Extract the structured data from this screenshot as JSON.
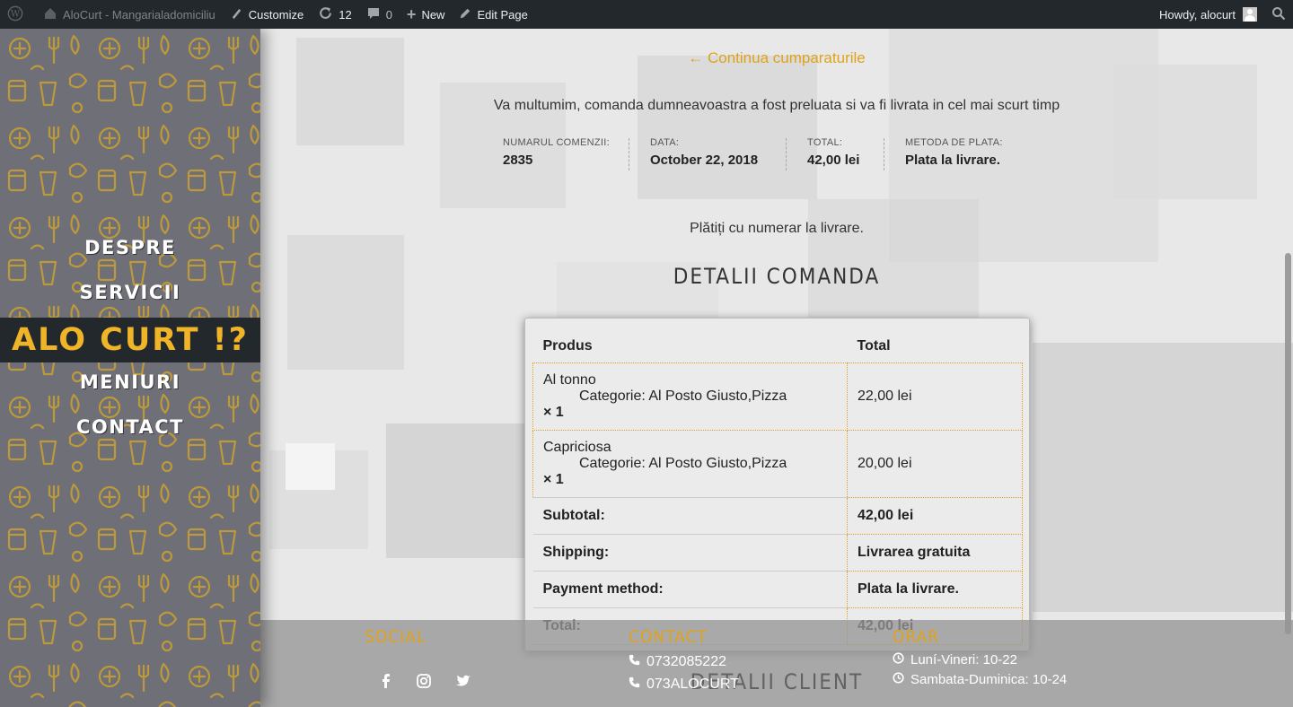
{
  "admin_bar": {
    "site_name": "AloCurt - Mangarialadomiciliu",
    "customize": "Customize",
    "updates_count": "12",
    "comments_count": "0",
    "new": "New",
    "edit_page": "Edit Page",
    "howdy": "Howdy, alocurt"
  },
  "sidebar": {
    "nav": [
      "DESPRE",
      "SERVICII",
      "MENIURI",
      "CONTACT"
    ],
    "logo_text": "ALO CURT !?",
    "accent": "#f0b429"
  },
  "main": {
    "continue_link": "← Continua cumparaturile",
    "thanks": "Va multumim, comanda dumneavoastra a fost preluata si va fi livrata in cel mai scurt timp",
    "overview": {
      "order_number_label": "NUMARUL COMENZII:",
      "order_number": "2835",
      "date_label": "DATA:",
      "date": "October 22, 2018",
      "total_label": "TOTAL:",
      "total": "42,00 lei",
      "method_label": "METODA DE PLATA:",
      "method": "Plata la livrare."
    },
    "payment_note": "Plătiți cu numerar la livrare.",
    "details_title": "DETALII COMANDA",
    "table": {
      "head_product": "Produs",
      "head_total": "Total",
      "items": [
        {
          "name": "Al tonno",
          "meta": "Categorie: Al Posto Giusto,Pizza",
          "qty": "× 1",
          "total": "22,00 lei"
        },
        {
          "name": "Capriciosa",
          "meta": "Categorie: Al Posto Giusto,Pizza",
          "qty": "× 1",
          "total": "20,00 lei"
        }
      ],
      "totals": [
        {
          "label": "Subtotal:",
          "value": "42,00 lei"
        },
        {
          "label": "Shipping:",
          "value": "Livrarea gratuita"
        },
        {
          "label": "Payment method:",
          "value": "Plata la livrare."
        },
        {
          "label": "Total:",
          "value": "42,00 lei"
        }
      ]
    },
    "client_title": "DETALII CLIENT"
  },
  "footer": {
    "social_heading": "SOCIAL",
    "contact_heading": "CONTACT",
    "hours_heading": "ORAR",
    "phones": [
      "0732085222",
      "073ALOCURT"
    ],
    "hours": [
      "Luní-Vineri: 10-22",
      "Sambata-Duminica: 10-24"
    ],
    "social_icons": [
      "facebook-icon",
      "instagram-icon",
      "twitter-icon"
    ]
  }
}
